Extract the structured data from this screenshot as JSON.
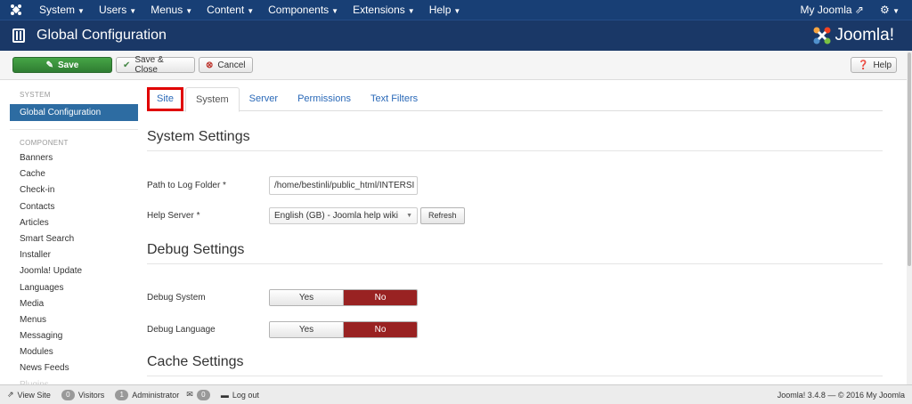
{
  "topnav": {
    "items": [
      "System",
      "Users",
      "Menus",
      "Content",
      "Components",
      "Extensions",
      "Help"
    ],
    "my_site": "My Joomla"
  },
  "header": {
    "title": "Global Configuration",
    "brand": "Joomla!"
  },
  "toolbar": {
    "save": "Save",
    "save_close": "Save & Close",
    "cancel": "Cancel",
    "help": "Help"
  },
  "sidebar": {
    "system_header": "SYSTEM",
    "active_item": "Global Configuration",
    "component_header": "COMPONENT",
    "items": [
      "Banners",
      "Cache",
      "Check-in",
      "Contacts",
      "Articles",
      "Smart Search",
      "Installer",
      "Joomla! Update",
      "Languages",
      "Media",
      "Menus",
      "Messaging",
      "Modules",
      "News Feeds",
      "Plugins"
    ]
  },
  "tabs": [
    "Site",
    "System",
    "Server",
    "Permissions",
    "Text Filters"
  ],
  "system_settings": {
    "title": "System Settings",
    "log_label": "Path to Log Folder *",
    "log_value": "/home/bestinli/public_html/INTERSI",
    "help_label": "Help Server *",
    "help_value": "English (GB) - Joomla help wiki",
    "refresh": "Refresh"
  },
  "debug_settings": {
    "title": "Debug Settings",
    "debug_system_label": "Debug System",
    "debug_language_label": "Debug Language",
    "yes": "Yes",
    "no": "No"
  },
  "cache_settings": {
    "title": "Cache Settings"
  },
  "footer": {
    "view_site": "View Site",
    "visitors_count": "0",
    "visitors": "Visitors",
    "admin_count": "1",
    "administrator": "Administrator",
    "msg_count": "0",
    "logout": "Log out",
    "version": "Joomla! 3.4.8 — © 2016 My Joomla"
  },
  "colors": {
    "navbar": "#183f75",
    "header": "#1a3867",
    "save_green": "#46a546",
    "active_sidebar": "#2d6ca2",
    "toggle_no": "#992222",
    "highlight_box": "#e00000"
  }
}
